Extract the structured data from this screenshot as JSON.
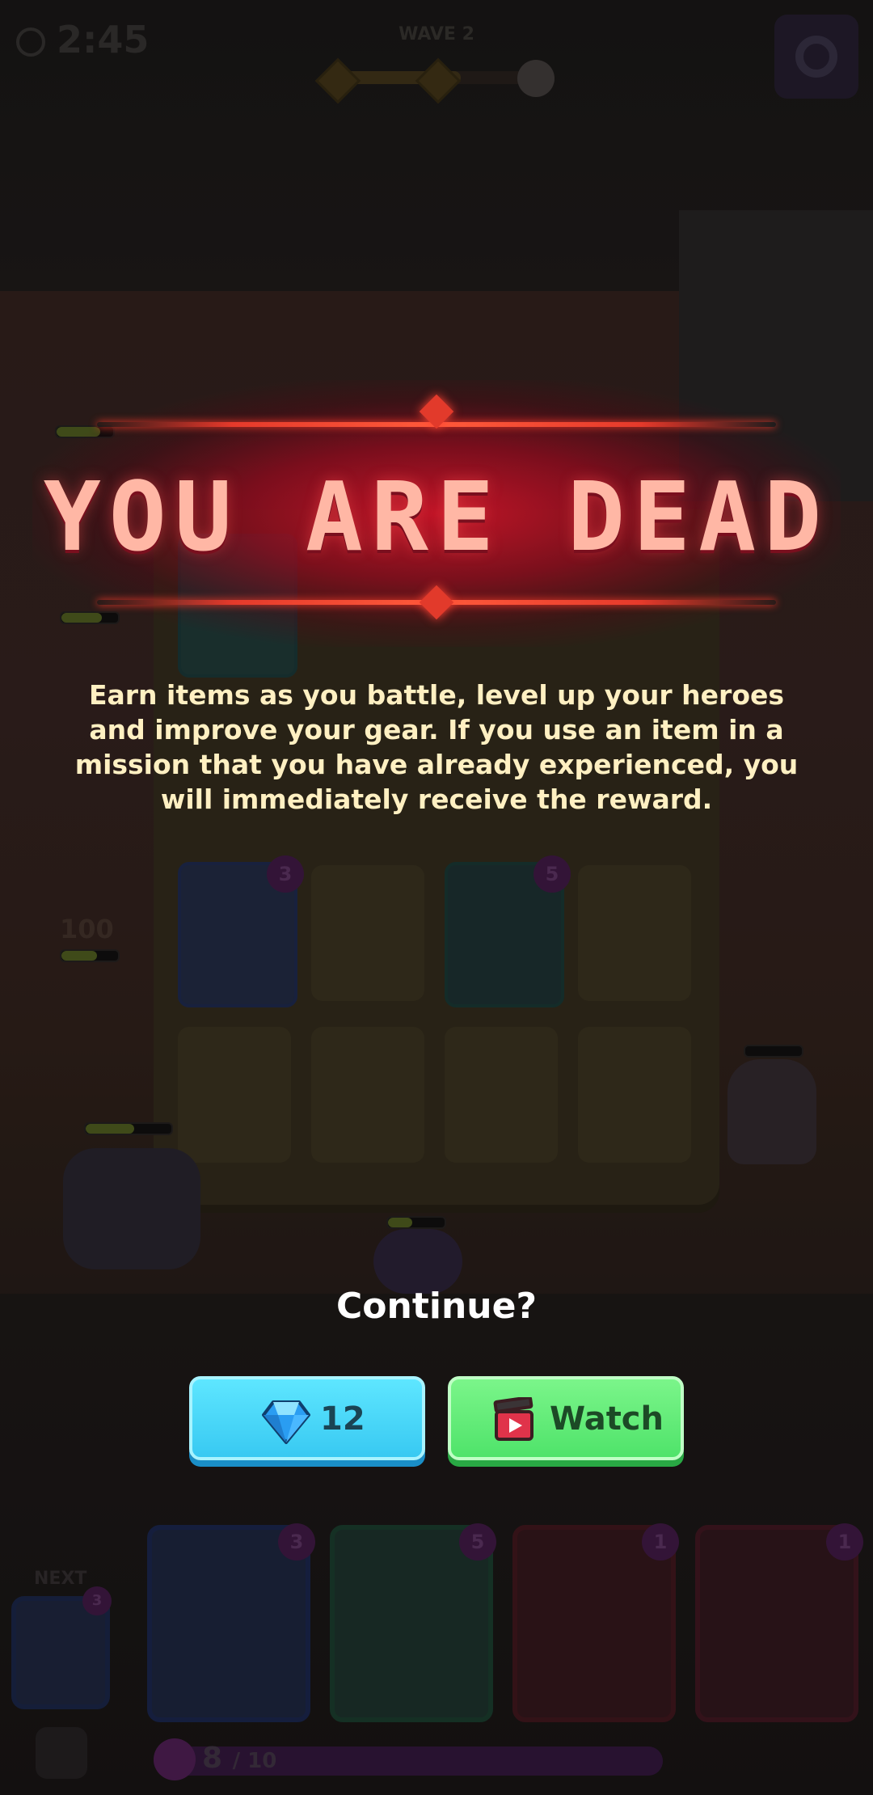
{
  "hud": {
    "timer": "2:45",
    "wave_label": "WAVE 2",
    "wave_nodes": [
      "1",
      "2"
    ]
  },
  "board": {
    "hp_value": "100",
    "hand_costs": [
      "3",
      "5",
      "1",
      "1"
    ],
    "next_label": "NEXT",
    "next_cost": "3",
    "board_costs": [
      "3",
      "5"
    ],
    "energy": "8",
    "energy_max": "/ 10"
  },
  "dialog": {
    "title": "YOU ARE DEAD",
    "description": "Earn items as you battle, level up your heroes and improve your gear. If you use an item in a mission that you have already experienced, you will immediately receive the reward.",
    "continue_label": "Continue?",
    "gem_button_value": "12",
    "watch_button_label": "Watch"
  },
  "colors": {
    "title": "#ffb7a5",
    "description": "#fff0c2",
    "gem_button": "#38c9f2",
    "watch_button": "#4fe36a"
  },
  "icons": [
    "timer-icon",
    "skull-icon",
    "gear-icon",
    "gem-icon",
    "clapperboard-icon",
    "trash-icon",
    "energy-drop-icon"
  ]
}
